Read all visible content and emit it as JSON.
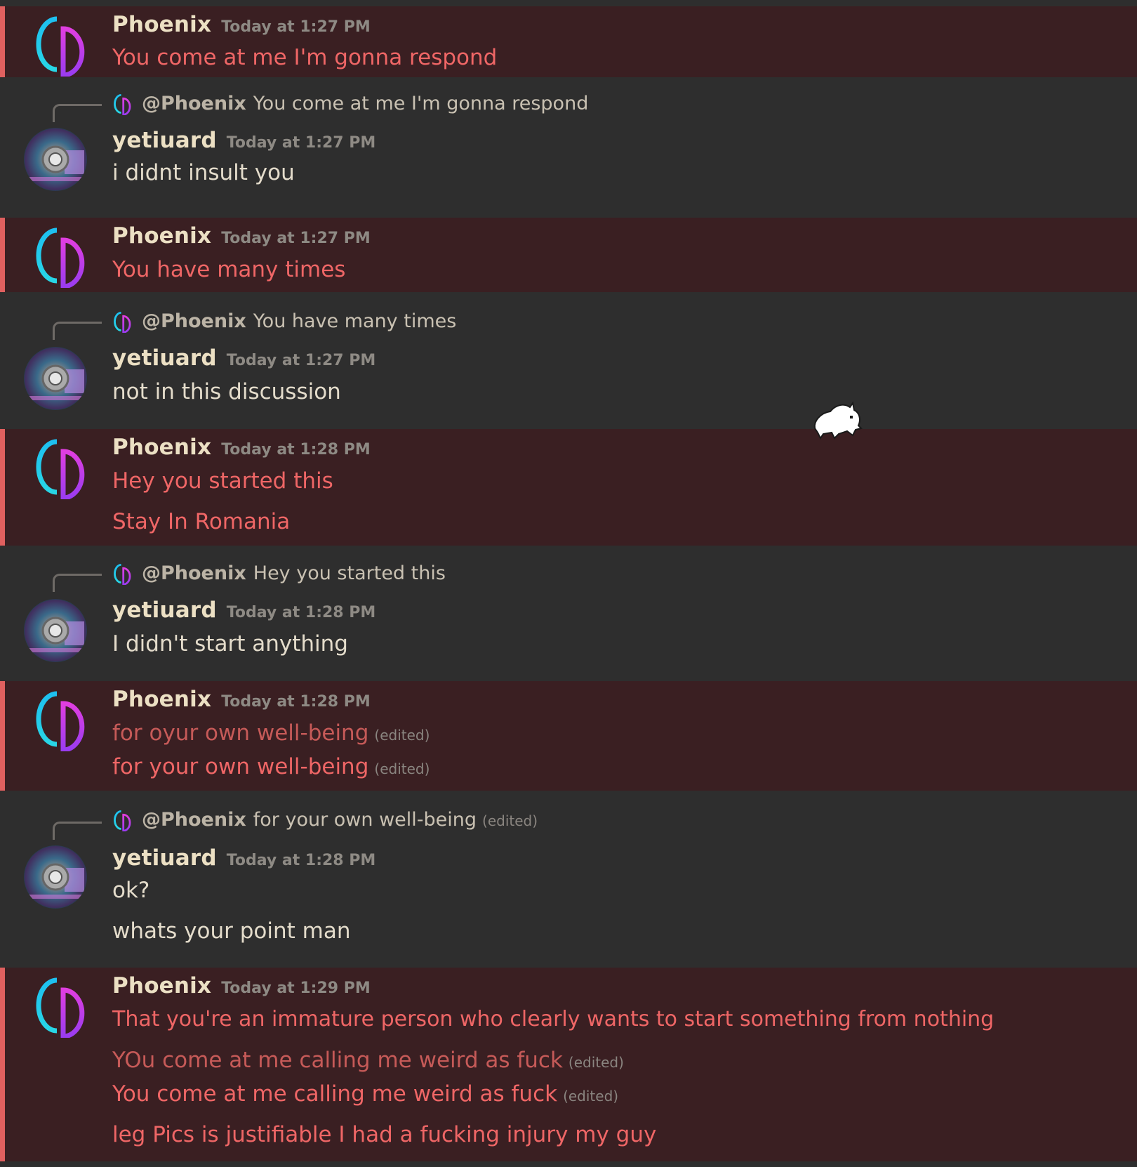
{
  "messages": [
    {
      "author": "Phoenix",
      "timestamp": "Today at 1:27 PM",
      "lines": [
        "You come at me I'm gonna respond"
      ]
    },
    {
      "author": "yetiuard",
      "timestamp": "Today at 1:27 PM",
      "reply": {
        "mention": "@Phoenix",
        "text": "You come at me I'm gonna respond"
      },
      "lines": [
        "i didnt insult you"
      ]
    },
    {
      "author": "Phoenix",
      "timestamp": "Today at 1:27 PM",
      "lines": [
        "You have many times"
      ]
    },
    {
      "author": "yetiuard",
      "timestamp": "Today at 1:27 PM",
      "reply": {
        "mention": "@Phoenix",
        "text": "You have many times"
      },
      "lines": [
        "not in this discussion"
      ]
    },
    {
      "author": "Phoenix",
      "timestamp": "Today at 1:28 PM",
      "lines": [
        "Hey you started this",
        "Stay In Romania"
      ]
    },
    {
      "author": "yetiuard",
      "timestamp": "Today at 1:28 PM",
      "reply": {
        "mention": "@Phoenix",
        "text": "Hey you started this"
      },
      "lines": [
        "I didn't start anything"
      ]
    },
    {
      "author": "Phoenix",
      "timestamp": "Today at 1:28 PM",
      "lines": [
        "for oyur own well-being",
        "for your own well-being"
      ],
      "edited_label": "(edited)"
    },
    {
      "author": "yetiuard",
      "timestamp": "Today at 1:28 PM",
      "reply": {
        "mention": "@Phoenix",
        "text": "for your own well-being",
        "edited": "(edited)"
      },
      "lines": [
        "ok?",
        "whats your point man"
      ]
    },
    {
      "author": "Phoenix",
      "timestamp": "Today at 1:29 PM",
      "lines": [
        "That you're an immature person who clearly wants to start something from nothing",
        "YOu come at me calling me weird as fuck",
        "You come at me calling me weird as fuck",
        "leg Pics is justifiable I had a fucking injury my guy"
      ],
      "edited_label": "(edited)"
    }
  ],
  "colors": {
    "background": "#2e2e2e",
    "highlight_bg": "#3a1f22",
    "highlight_bar": "#e0605f",
    "mention_text": "#ef6666",
    "username": "#ece0c4",
    "timestamp": "#8e8a84",
    "logo_cyan": "#22c8ee",
    "logo_magenta": "#c43ae8"
  },
  "icons": {
    "phoenix_avatar": "yuzu-logo-icon",
    "yetiuard_avatar": "disc-avatar-icon",
    "reply_spine": "reply-spine-icon",
    "cursor": "cat-cursor-icon"
  }
}
